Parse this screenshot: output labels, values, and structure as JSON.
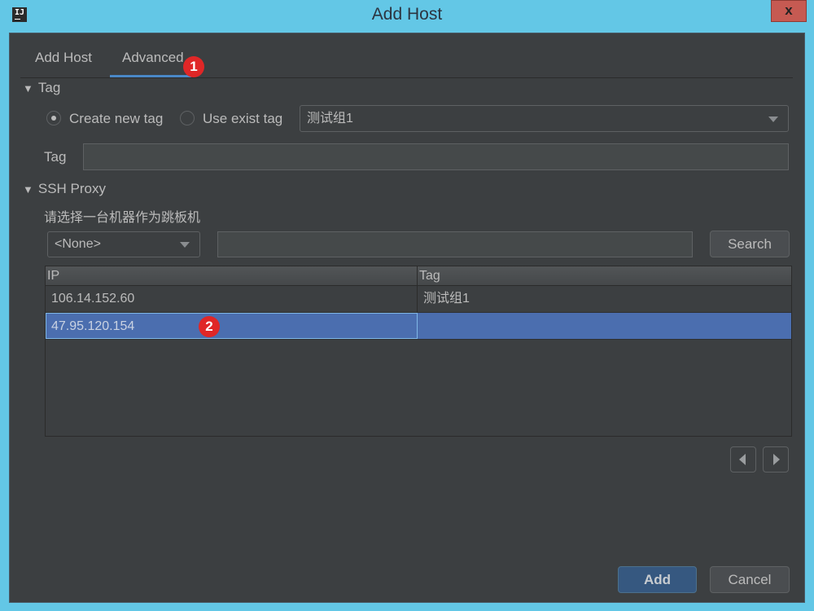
{
  "window": {
    "title": "Add Host",
    "app_icon_label": "IJ",
    "close_label": "x"
  },
  "tabs": [
    {
      "label": "Add Host",
      "active": false
    },
    {
      "label": "Advanced",
      "active": true
    }
  ],
  "annotations": {
    "badge1": "1",
    "badge2": "2"
  },
  "tag_section": {
    "header": "Tag",
    "radio_create": {
      "label": "Create new tag",
      "checked": true
    },
    "radio_use": {
      "label": "Use exist tag",
      "checked": false
    },
    "existing_tag_select": {
      "value": "测试组1"
    },
    "tag_field_label": "Tag",
    "tag_field_value": ""
  },
  "ssh_proxy": {
    "header": "SSH Proxy",
    "hint": "请选择一台机器作为跳板机",
    "filter_select": {
      "value": "<None>"
    },
    "search_input": {
      "value": ""
    },
    "search_button": "Search",
    "table": {
      "columns": [
        "IP",
        "Tag"
      ],
      "rows": [
        {
          "ip": "106.14.152.60",
          "tag": "测试组1",
          "selected": false
        },
        {
          "ip": "47.95.120.154",
          "tag": "",
          "selected": true
        }
      ]
    }
  },
  "pager": {
    "prev": "previous-page",
    "next": "next-page"
  },
  "footer": {
    "add_label": "Add",
    "cancel_label": "Cancel"
  },
  "colors": {
    "window_frame": "#63c7e6",
    "background": "#3c3f41",
    "accent": "#4a88c7",
    "selection": "#4b6eaf",
    "badge": "#e02727",
    "close": "#c65a52"
  }
}
